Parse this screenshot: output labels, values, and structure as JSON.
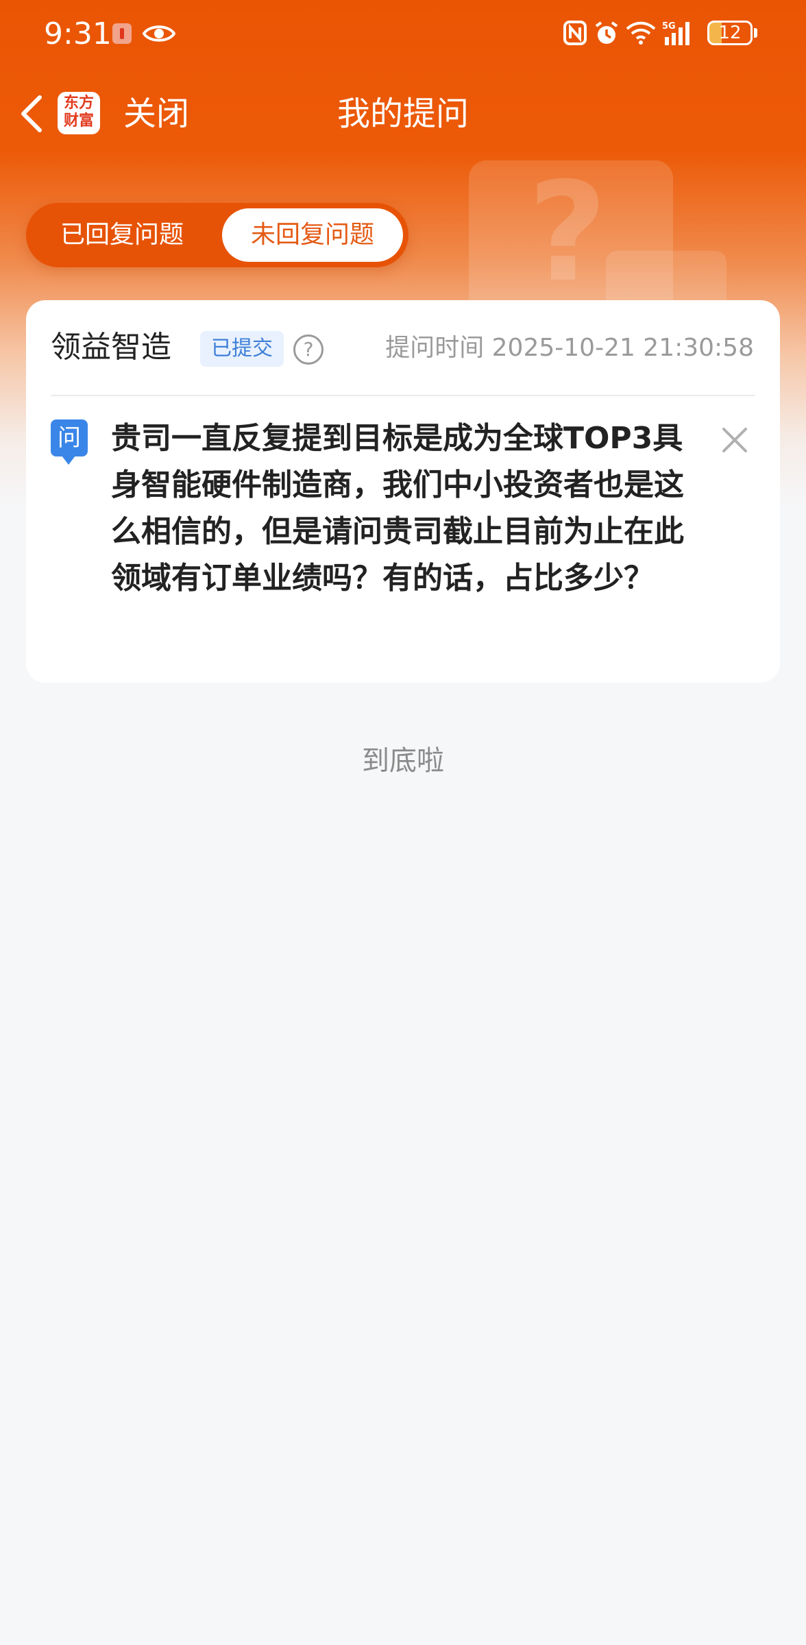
{
  "status_bar": {
    "time": "9:31",
    "battery": "12"
  },
  "nav": {
    "logo_line1": "东方",
    "logo_line2": "财富",
    "close_label": "关闭",
    "title": "我的提问"
  },
  "tabs": [
    {
      "label": "已回复问题",
      "active": false
    },
    {
      "label": "未回复问题",
      "active": true
    }
  ],
  "question": {
    "company": "领益智造",
    "status": "已提交",
    "help_glyph": "?",
    "time_label": "提问时间 2025-10-21 21:30:58",
    "icon_label": "问",
    "text": "贵司一直反复提到目标是成为全球TOP3具身智能硬件制造商，我们中小投资者也是这么相信的，但是请问贵司截止目前为止在此领域有订单业绩吗？有的话，占比多少？"
  },
  "footer": {
    "end_text": "到底啦"
  },
  "colors": {
    "brand_orange": "#ea5504",
    "question_icon_blue": "#3a86e8",
    "status_badge_text": "#3f7fd8"
  }
}
